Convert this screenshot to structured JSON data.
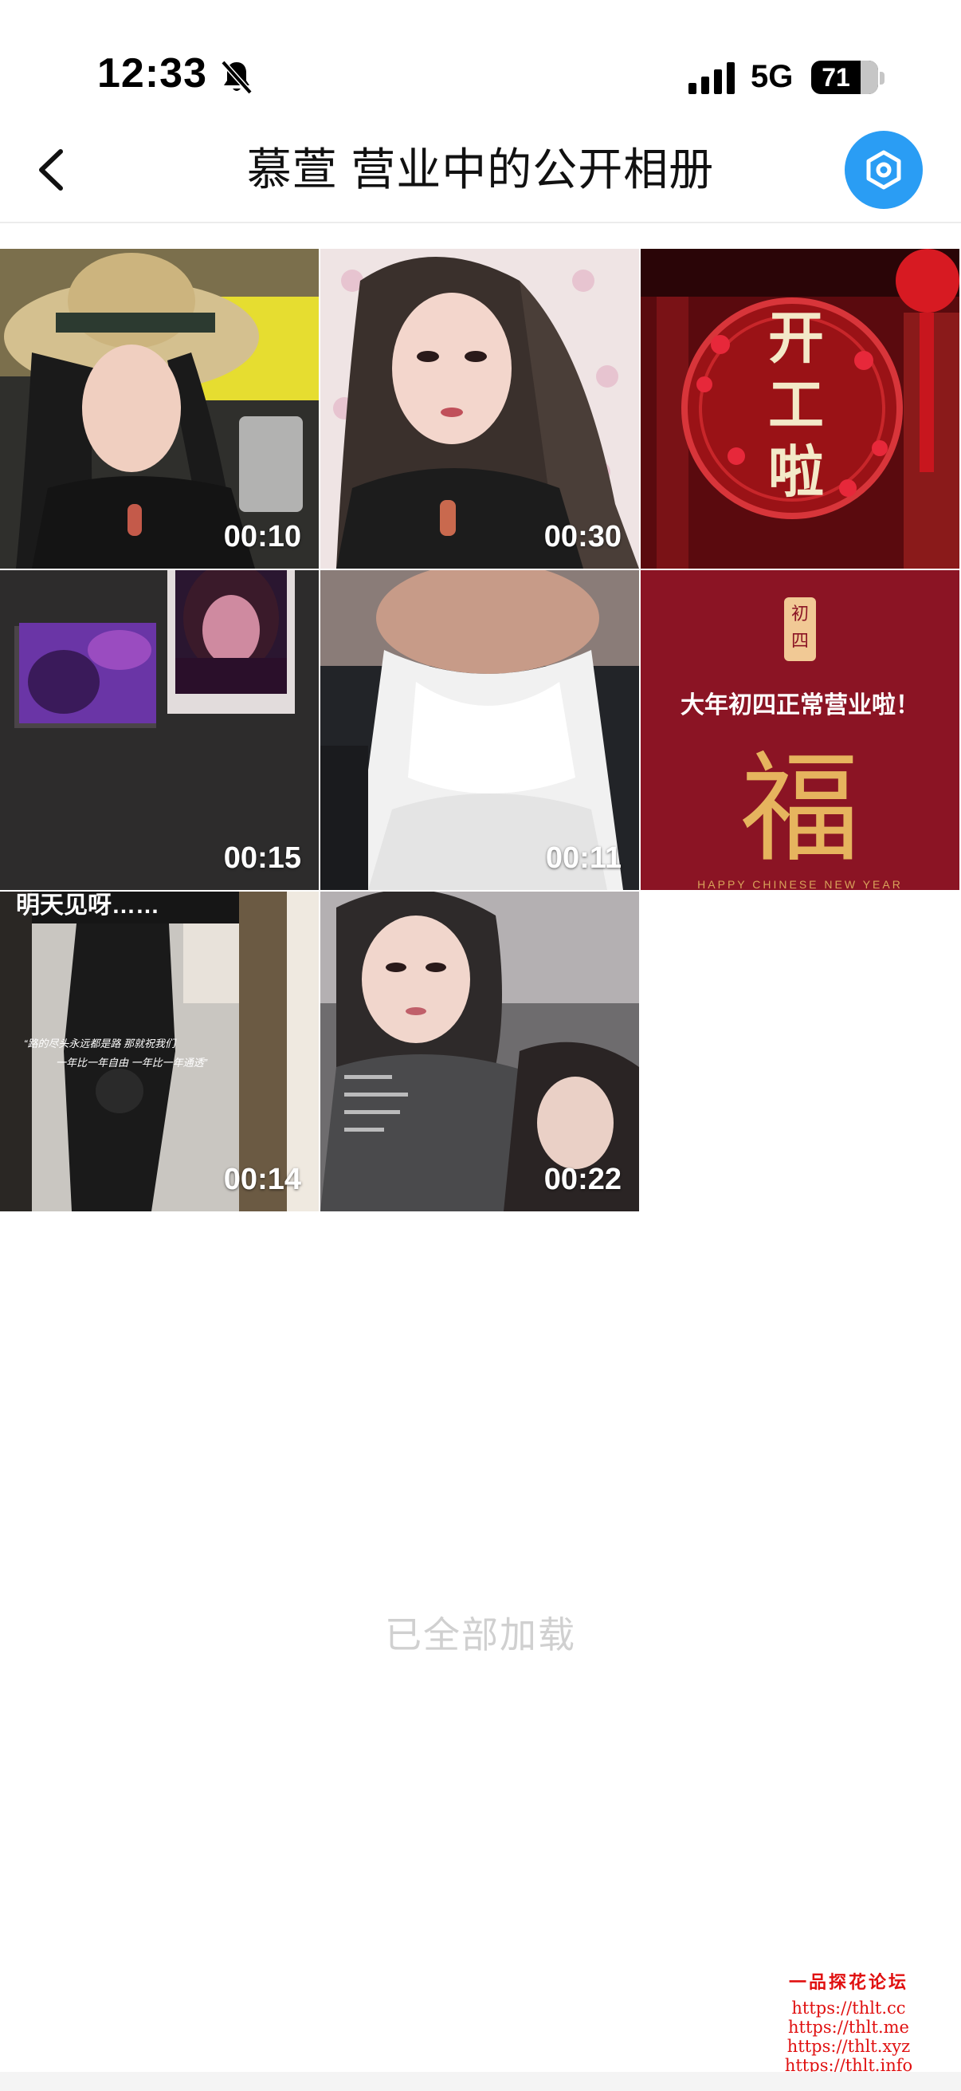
{
  "status_bar": {
    "time": "12:33",
    "network": "5G",
    "battery": "71"
  },
  "nav": {
    "title": "慕萱 营业中的公开相册"
  },
  "grid": {
    "items": [
      {
        "duration": "00:10",
        "icon": "video-thumbnail"
      },
      {
        "duration": "00:30",
        "icon": "video-thumbnail"
      },
      {
        "caption": "开工啦",
        "icon": "image-thumbnail"
      },
      {
        "duration": "00:15",
        "icon": "video-thumbnail"
      },
      {
        "duration": "00:11",
        "icon": "video-thumbnail"
      },
      {
        "badge": "初四",
        "caption": "大年初四正常营业啦！",
        "glyph": "福",
        "footer": "HAPPY CHINESE NEW YEAR",
        "icon": "image-thumbnail"
      },
      {
        "top_text": "明天见呀……",
        "quote_1": "“路的尽头永远都是路 那就祝我们",
        "quote_2": "一年比一年自由 一年比一年通透”",
        "duration": "00:14",
        "icon": "video-thumbnail"
      },
      {
        "duration": "00:22",
        "icon": "video-thumbnail"
      }
    ]
  },
  "footer": {
    "status": "已全部加载"
  },
  "watermark": {
    "title": "一品探花论坛",
    "urls": [
      "https://thlt.cc",
      "https://thlt.me",
      "https://thlt.xyz",
      "https://thlt.info"
    ]
  },
  "colors": {
    "accent": "#2a9df4",
    "footer_text": "#d0d0d0",
    "watermark": "#e01010"
  }
}
